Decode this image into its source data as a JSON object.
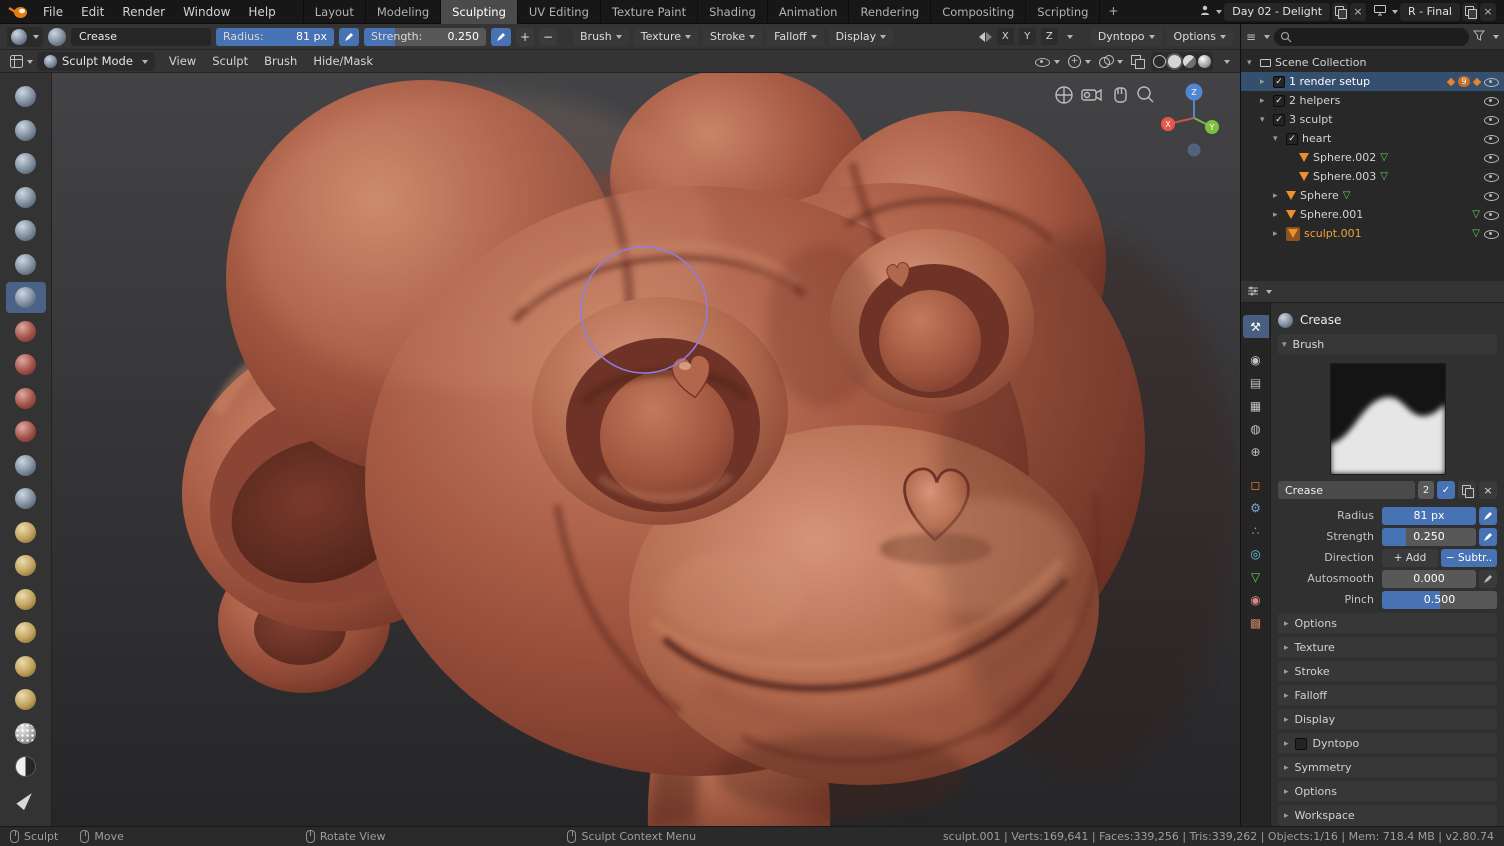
{
  "topbar": {
    "menus": [
      "File",
      "Edit",
      "Render",
      "Window",
      "Help"
    ],
    "workspaces": [
      "Layout",
      "Modeling",
      "Sculpting",
      "UV Editing",
      "Texture Paint",
      "Shading",
      "Animation",
      "Rendering",
      "Compositing",
      "Scripting"
    ],
    "add_workspace": "+",
    "scene_name": "Day 02 - Delight",
    "view_layer_name": "R - Final",
    "close_glyph": "×"
  },
  "tool_settings": {
    "brush_name": "Crease",
    "radius_label": "Radius:",
    "radius_value": "81 px",
    "strength_label": "Strength:",
    "strength_value": "0.250",
    "add_glyph": "+",
    "remove_glyph": "−",
    "popovers": [
      "Brush",
      "Texture",
      "Stroke",
      "Falloff",
      "Display"
    ],
    "axis_x": "X",
    "axis_y": "Y",
    "axis_z": "Z",
    "dyntopo": "Dyntopo",
    "options": "Options"
  },
  "mode_header": {
    "mode": "Sculpt Mode",
    "menus": [
      "View",
      "Sculpt",
      "Brush",
      "Hide/Mask"
    ]
  },
  "toolbar": {
    "tools": [
      "draw",
      "clay",
      "clay-strips",
      "layer",
      "inflate",
      "blob",
      "crease",
      "smooth",
      "flatten",
      "fill",
      "scrape",
      "pinch",
      "grab",
      "elastic-deform",
      "snake-hook",
      "thumb",
      "pose",
      "nudge",
      "rotate",
      "mask",
      "box-mask",
      "annotate"
    ],
    "active_tool": "crease"
  },
  "viewport": {
    "axis_x": "X",
    "axis_y": "Y",
    "axis_z": "Z"
  },
  "outliner": {
    "root": "Scene Collection",
    "items": [
      {
        "label": "1 render setup",
        "badge": "9"
      },
      {
        "label": "2 helpers"
      },
      {
        "label": "3 sculpt"
      },
      {
        "label": "heart"
      },
      {
        "label": "Sphere.002"
      },
      {
        "label": "Sphere.003"
      },
      {
        "label": "Sphere"
      },
      {
        "label": "Sphere.001"
      },
      {
        "label": "sculpt.001"
      }
    ]
  },
  "properties": {
    "tool_title": "Crease",
    "brush_panel": "Brush",
    "brush_name": "Crease",
    "brush_users": "2",
    "rows": {
      "radius": {
        "label": "Radius",
        "value": "81 px"
      },
      "strength": {
        "label": "Strength",
        "value": "0.250"
      },
      "direction": {
        "label": "Direction",
        "add": "+ Add",
        "subtract": "− Subtr.."
      },
      "autosmooth": {
        "label": "Autosmooth",
        "value": "0.000"
      },
      "pinch": {
        "label": "Pinch",
        "value": "0.500"
      }
    },
    "panels": [
      "Options",
      "Texture",
      "Stroke",
      "Falloff",
      "Display",
      "Dyntopo",
      "Symmetry",
      "Options",
      "Workspace"
    ],
    "tabs": [
      {
        "name": "active-tool",
        "glyph": "⚒"
      },
      {
        "name": "render",
        "glyph": "◉"
      },
      {
        "name": "output",
        "glyph": "▤"
      },
      {
        "name": "view-layer",
        "glyph": "▦"
      },
      {
        "name": "scene",
        "glyph": "◍"
      },
      {
        "name": "world",
        "glyph": "⊕"
      },
      {
        "name": "object",
        "glyph": "◻"
      },
      {
        "name": "modifiers",
        "glyph": "⚙"
      },
      {
        "name": "particles",
        "glyph": "∴"
      },
      {
        "name": "physics",
        "glyph": "◎"
      },
      {
        "name": "object-data",
        "glyph": "▽"
      },
      {
        "name": "material",
        "glyph": "◉"
      },
      {
        "name": "texture",
        "glyph": "▩"
      }
    ]
  },
  "statusbar": {
    "hints": [
      "Sculpt",
      "Move",
      "Rotate View",
      "Sculpt Context Menu"
    ],
    "stats": "sculpt.001 | Verts:169,641 | Faces:339,256 | Tris:339,262 | Objects:1/16 | Mem: 718.4 MB | v2.80.74"
  },
  "colors": {
    "accent": "#4772b3",
    "selection": "#35506f",
    "active_object": "#efa13a",
    "clay_base": "#a85c45"
  }
}
